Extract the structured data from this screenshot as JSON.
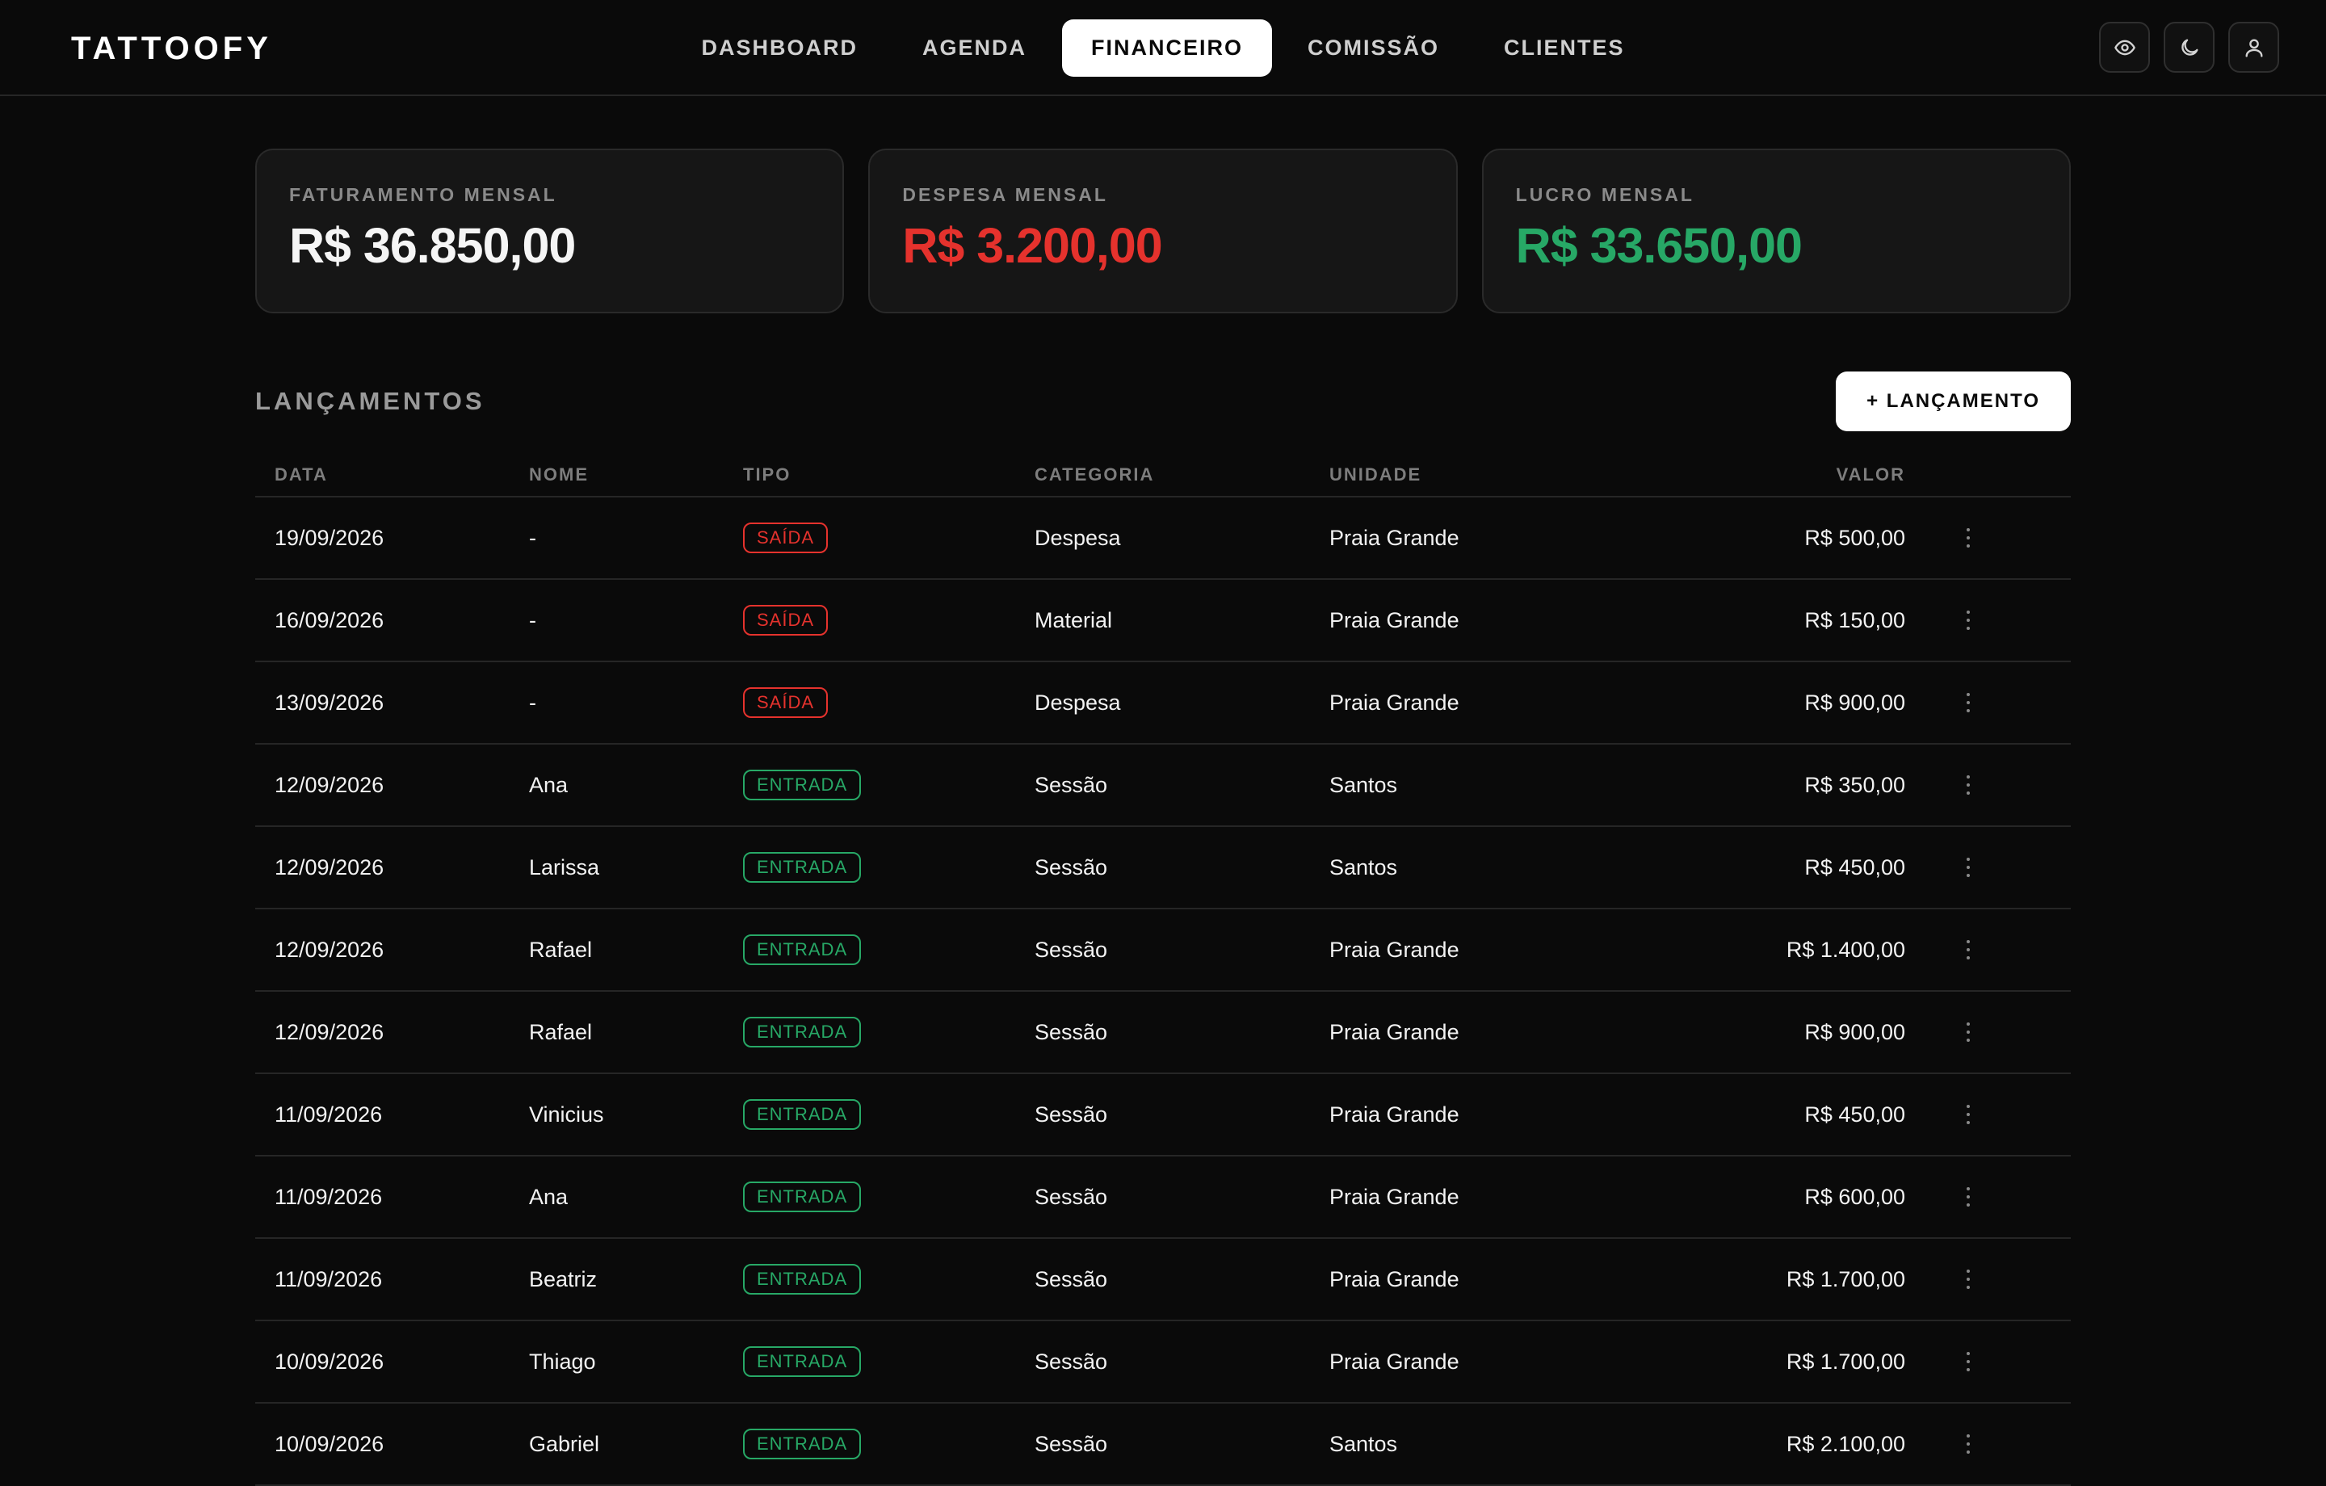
{
  "app": {
    "brand": "TATTOOFY"
  },
  "nav": {
    "items": [
      {
        "label": "DASHBOARD",
        "active": false
      },
      {
        "label": "AGENDA",
        "active": false
      },
      {
        "label": "FINANCEIRO",
        "active": true
      },
      {
        "label": "COMISSÃO",
        "active": false
      },
      {
        "label": "CLIENTES",
        "active": false
      }
    ]
  },
  "header_actions": {
    "icons": [
      "eye-icon",
      "moon-icon",
      "user-icon"
    ]
  },
  "summary": {
    "revenue": {
      "label": "FATURAMENTO MENSAL",
      "value": "R$ 36.850,00",
      "color": "#f5f5f5"
    },
    "expense": {
      "label": "DESPESA MENSAL",
      "value": "R$ 3.200,00",
      "color": "#e5322d"
    },
    "profit": {
      "label": "LUCRO MENSAL",
      "value": "R$ 33.650,00",
      "color": "#27a866"
    }
  },
  "entries": {
    "title": "LANÇAMENTOS",
    "add_button": "+ LANÇAMENTO",
    "columns": {
      "date": "DATA",
      "name": "NOME",
      "type": "TIPO",
      "category": "CATEGORIA",
      "unit": "UNIDADE",
      "value": "VALOR"
    },
    "rows": [
      {
        "date": "19/09/2026",
        "name": "-",
        "type": "SAÍDA",
        "kind": "out",
        "category": "Despesa",
        "unit": "Praia Grande",
        "value": "R$ 500,00"
      },
      {
        "date": "16/09/2026",
        "name": "-",
        "type": "SAÍDA",
        "kind": "out",
        "category": "Material",
        "unit": "Praia Grande",
        "value": "R$ 150,00"
      },
      {
        "date": "13/09/2026",
        "name": "-",
        "type": "SAÍDA",
        "kind": "out",
        "category": "Despesa",
        "unit": "Praia Grande",
        "value": "R$ 900,00"
      },
      {
        "date": "12/09/2026",
        "name": "Ana",
        "type": "ENTRADA",
        "kind": "in",
        "category": "Sessão",
        "unit": "Santos",
        "value": "R$ 350,00"
      },
      {
        "date": "12/09/2026",
        "name": "Larissa",
        "type": "ENTRADA",
        "kind": "in",
        "category": "Sessão",
        "unit": "Santos",
        "value": "R$ 450,00"
      },
      {
        "date": "12/09/2026",
        "name": "Rafael",
        "type": "ENTRADA",
        "kind": "in",
        "category": "Sessão",
        "unit": "Praia Grande",
        "value": "R$ 1.400,00"
      },
      {
        "date": "12/09/2026",
        "name": "Rafael",
        "type": "ENTRADA",
        "kind": "in",
        "category": "Sessão",
        "unit": "Praia Grande",
        "value": "R$ 900,00"
      },
      {
        "date": "11/09/2026",
        "name": "Vinicius",
        "type": "ENTRADA",
        "kind": "in",
        "category": "Sessão",
        "unit": "Praia Grande",
        "value": "R$ 450,00"
      },
      {
        "date": "11/09/2026",
        "name": "Ana",
        "type": "ENTRADA",
        "kind": "in",
        "category": "Sessão",
        "unit": "Praia Grande",
        "value": "R$ 600,00"
      },
      {
        "date": "11/09/2026",
        "name": "Beatriz",
        "type": "ENTRADA",
        "kind": "in",
        "category": "Sessão",
        "unit": "Praia Grande",
        "value": "R$ 1.700,00"
      },
      {
        "date": "10/09/2026",
        "name": "Thiago",
        "type": "ENTRADA",
        "kind": "in",
        "category": "Sessão",
        "unit": "Praia Grande",
        "value": "R$ 1.700,00"
      },
      {
        "date": "10/09/2026",
        "name": "Gabriel",
        "type": "ENTRADA",
        "kind": "in",
        "category": "Sessão",
        "unit": "Santos",
        "value": "R$ 2.100,00"
      }
    ]
  }
}
